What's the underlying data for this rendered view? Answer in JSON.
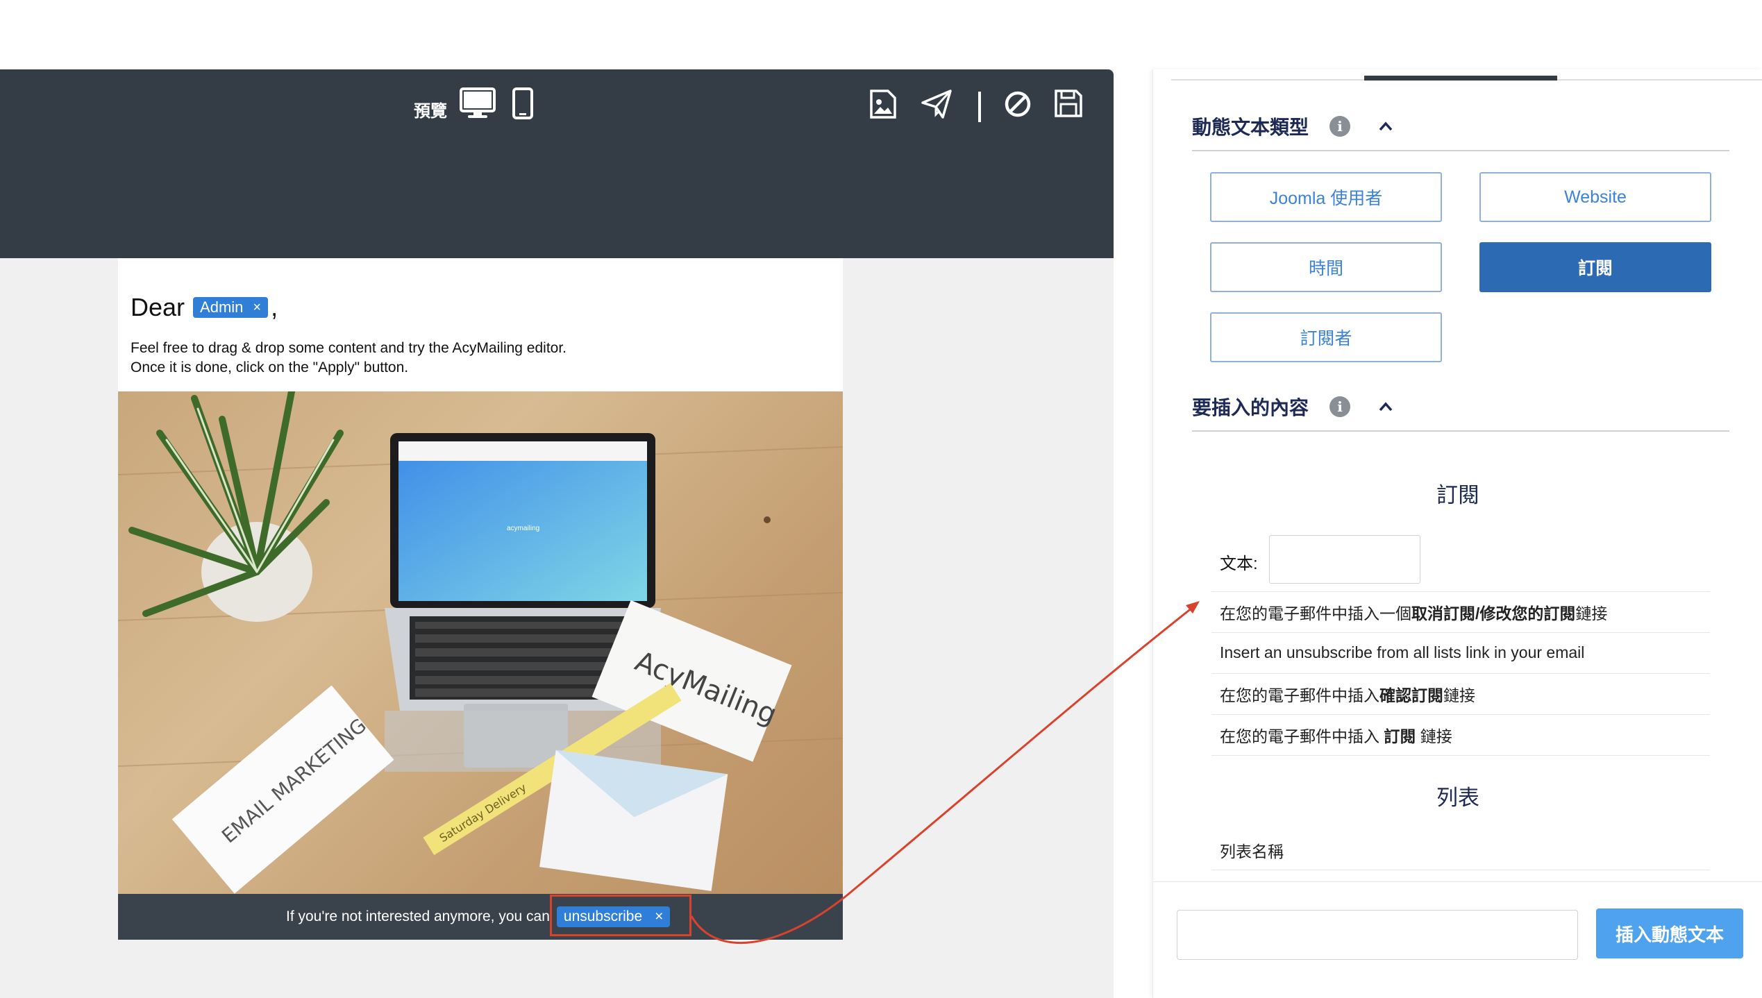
{
  "toolbar": {
    "preview_label": "預覽",
    "icons": [
      "desktop-icon",
      "mobile-icon",
      "image-icon",
      "send-icon",
      "cancel-icon",
      "save-icon"
    ]
  },
  "email": {
    "greeting": "Dear",
    "name_tag": "Admin",
    "tag_close": "×",
    "comma": ",",
    "intro_line1": "Feel free to drag & drop some content and try the AcyMailing editor.",
    "intro_line2": "Once it is done, click on the \"Apply\" button.",
    "photo_screen_brand": "acymailing",
    "photo_card_right": "AcyMailing",
    "photo_card_left": "EMAIL MARKETING",
    "photo_tape": "Saturday Delivery",
    "footer_text": "If you're not interested anymore, you can",
    "unsubscribe_tag": "unsubscribe",
    "unsubscribe_close": "×"
  },
  "panel": {
    "section1_title": "動態文本類型",
    "section1_info": "i",
    "section1_chevron": "^",
    "types": [
      {
        "label": "Joomla 使用者",
        "active": false
      },
      {
        "label": "Website",
        "active": false
      },
      {
        "label": "時間",
        "active": false
      },
      {
        "label": "訂閱",
        "active": true
      },
      {
        "label": "訂閱者",
        "active": false
      }
    ],
    "section2_title": "要插入的內容",
    "section2_info": "i",
    "section2_chevron": "^",
    "subscription_heading": "訂閱",
    "text_label": "文本:",
    "text_value": "",
    "options": [
      {
        "pre": "在您的電子郵件中插入一個",
        "bold": "取消訂閱/修改您的訂閱",
        "post": "鏈接"
      },
      {
        "pre": "Insert an unsubscribe from all lists link in your email",
        "bold": "",
        "post": ""
      },
      {
        "pre": "在您的電子郵件中插入",
        "bold": "確認訂閱",
        "post": "鏈接"
      },
      {
        "pre": "在您的電子郵件中插入 ",
        "bold": "訂閱",
        "post": " 鏈接"
      }
    ],
    "list_heading": "列表",
    "list_option": "列表名稱",
    "insert_value": "",
    "insert_button": "插入動態文本"
  },
  "colors": {
    "toolbar_bg": "#343d45",
    "accent_blue": "#2d6ab4",
    "button_blue": "#4ea2ee",
    "arrow_red": "#d9432e"
  }
}
